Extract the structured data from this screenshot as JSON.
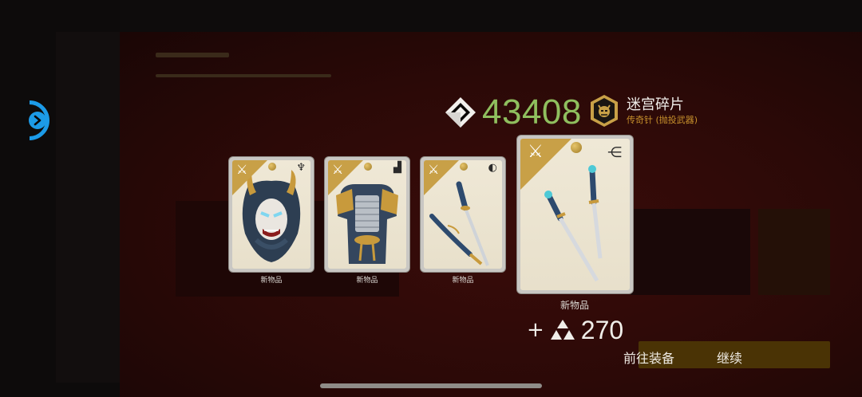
{
  "currency": {
    "icon": "labyrinth-gem-icon",
    "amount": "43408",
    "amount_color": "#8fbf5e"
  },
  "reward": {
    "icon": "oni-mask-badge-icon",
    "title": "迷宫碎片",
    "subtitle": "传奇针 (抛投武器)",
    "subtitle_color": "#c8912c"
  },
  "cards": [
    {
      "label": "新物品",
      "corner_icon": "dragonfly-icon",
      "type_icon": "helmet-type-icon",
      "art": "oni-mask-helmet-icon"
    },
    {
      "label": "新物品",
      "corner_icon": "dragonfly-icon",
      "type_icon": "armor-type-icon",
      "art": "samurai-armor-icon"
    },
    {
      "label": "新物品",
      "corner_icon": "dragonfly-icon",
      "type_icon": "sword-type-icon",
      "art": "katana-pair-icon"
    },
    {
      "label": "新物品",
      "corner_icon": "dragonfly-icon",
      "type_icon": "throwing-weapon-type-icon",
      "art": "throwing-needles-icon"
    }
  ],
  "bonus": {
    "plus": "+",
    "icon": "triforce-shard-icon",
    "amount": "270"
  },
  "actions": {
    "equip_label": "前往装备",
    "continue_label": "继续"
  },
  "colors": {
    "card_corner": "#c8a047",
    "back_button": "#1c9be8",
    "background_red": "#3a0c0a"
  }
}
